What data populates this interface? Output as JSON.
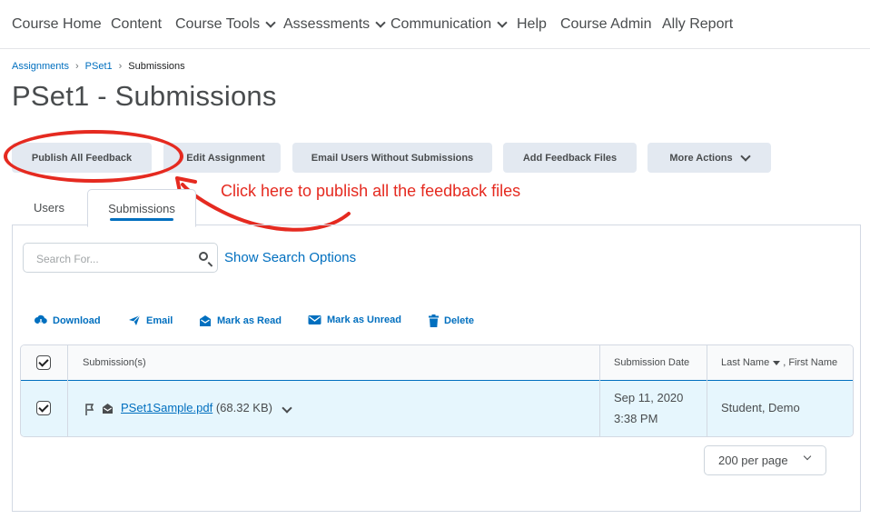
{
  "nav": [
    {
      "label": "Course Home",
      "dropdown": false
    },
    {
      "label": "Content",
      "dropdown": false
    },
    {
      "label": "Course Tools",
      "dropdown": true
    },
    {
      "label": "Assessments",
      "dropdown": true
    },
    {
      "label": "Communication",
      "dropdown": true
    },
    {
      "label": "Help",
      "dropdown": false
    },
    {
      "label": "Course Admin",
      "dropdown": false
    },
    {
      "label": "Ally Report",
      "dropdown": false
    }
  ],
  "breadcrumb": [
    "Assignments",
    "PSet1",
    "Submissions"
  ],
  "page_title": "PSet1 - Submissions",
  "buttons": {
    "publish": "Publish All Feedback",
    "edit": "Edit Assignment",
    "email_users": "Email Users Without Submissions",
    "add_feedback": "Add Feedback Files",
    "more_actions": "More Actions"
  },
  "annotation": {
    "text": "Click here to publish all the feedback files",
    "color": "#e52a20"
  },
  "tabs": [
    "Users",
    "Submissions"
  ],
  "active_tab": "Submissions",
  "search": {
    "placeholder": "Search For...",
    "value": "",
    "show_options": "Show Search Options"
  },
  "actions": [
    {
      "label": "Download",
      "icon": "download-icon"
    },
    {
      "label": "Email",
      "icon": "send-icon"
    },
    {
      "label": "Mark as Read",
      "icon": "mark-read-icon"
    },
    {
      "label": "Mark as Unread",
      "icon": "mark-unread-icon"
    },
    {
      "label": "Delete",
      "icon": "trash-icon"
    }
  ],
  "table": {
    "headers": {
      "submissions": "Submission(s)",
      "date": "Submission Date",
      "last_name": "Last Name",
      "first_name": ", First Name"
    },
    "rows": [
      {
        "checked": true,
        "file_name": "PSet1Sample.pdf",
        "file_size": "(68.32 KB)",
        "date_line1": "Sep 11, 2020",
        "date_line2": "3:38 PM",
        "name": "Student, Demo"
      }
    ]
  },
  "pagination": {
    "per_page": "200 per page"
  },
  "colors": {
    "accent": "#006fbf",
    "annotation": "#e52a20",
    "button_bg": "#e3e9f1",
    "row_selected": "#e6f6fd"
  }
}
